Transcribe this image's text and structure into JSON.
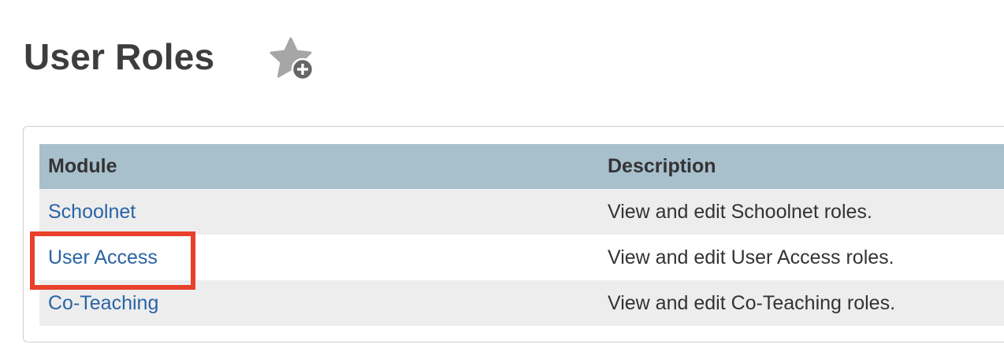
{
  "page": {
    "title": "User Roles"
  },
  "favorite": {
    "icon": "star-add-icon",
    "color": "#a6a6a6",
    "badge_color": "#666666"
  },
  "table": {
    "columns": [
      "Module",
      "Description"
    ],
    "header_color": "#a8bfcc",
    "link_color": "#2a64a4",
    "rows": [
      {
        "module": "Schoolnet",
        "description": "View and edit Schoolnet roles."
      },
      {
        "module": "User Access",
        "description": "View and edit User Access roles."
      },
      {
        "module": "Co-Teaching",
        "description": "View and edit Co-Teaching roles."
      }
    ]
  },
  "annotation": {
    "highlighted_row": "User Access",
    "color": "#e8402a"
  }
}
